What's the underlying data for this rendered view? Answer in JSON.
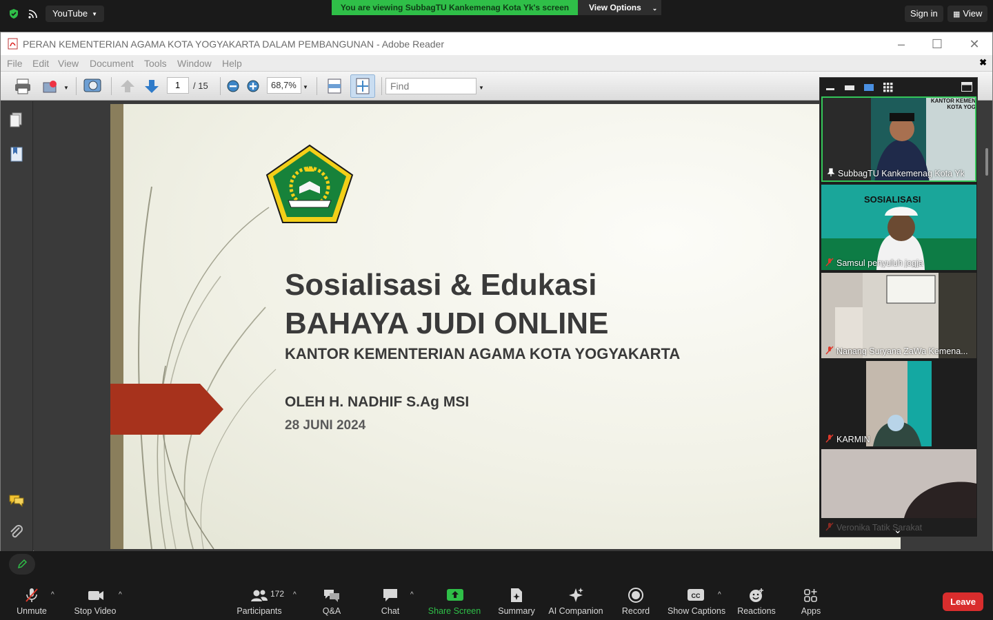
{
  "zoom_top": {
    "app_tab": "YouTube",
    "banner": "You are viewing SubbagTU Kankemenag Kota Yk's screen",
    "view_options": "View Options",
    "sign_in": "Sign in",
    "view": "View"
  },
  "adobe": {
    "title": "PERAN  KEMENTERIAN AGAMA KOTA YOGYAKARTA DALAM PEMBANGUNAN - Adobe Reader",
    "menu": [
      "File",
      "Edit",
      "View",
      "Document",
      "Tools",
      "Window",
      "Help"
    ],
    "page_current": "1",
    "page_total": "/ 15",
    "zoom": "68,7%",
    "find_placeholder": "Find"
  },
  "slide": {
    "title_line1": "Sosialisasi & Edukasi",
    "title_line2": "BAHAYA JUDI ONLINE",
    "subtitle": "KANTOR KEMENTERIAN AGAMA KOTA YOGYAKARTA",
    "author": "OLEH H. NADHIF S.Ag MSI",
    "date": "28 JUNI 2024",
    "accent_color": "#a7321c"
  },
  "participants": [
    {
      "name": "SubbagTU Kankemenag Kota Yk",
      "muted": false,
      "active": true
    },
    {
      "name": "Samsul penyuluh jogja",
      "muted": true,
      "active": false
    },
    {
      "name": "Nanang Suryana ZaWa Kemena...",
      "muted": true,
      "active": false
    },
    {
      "name": "KARMIN",
      "muted": true,
      "active": false
    },
    {
      "name": "Veronika Tatik Sarakat",
      "muted": true,
      "active": false
    }
  ],
  "tile_overlay": {
    "sosialisasi": "SOSIALISASI",
    "banner_text": "KANTOR KEMEN KOTA YOG"
  },
  "controls": {
    "unmute": "Unmute",
    "stop_video": "Stop Video",
    "participants": "Participants",
    "participants_count": "172",
    "qa": "Q&A",
    "chat": "Chat",
    "share_screen": "Share Screen",
    "summary": "Summary",
    "ai_companion": "AI Companion",
    "record": "Record",
    "show_captions": "Show Captions",
    "reactions": "Reactions",
    "apps": "Apps",
    "leave": "Leave"
  },
  "colors": {
    "share_green": "#2fbf48",
    "leave_red": "#d92d2d"
  }
}
